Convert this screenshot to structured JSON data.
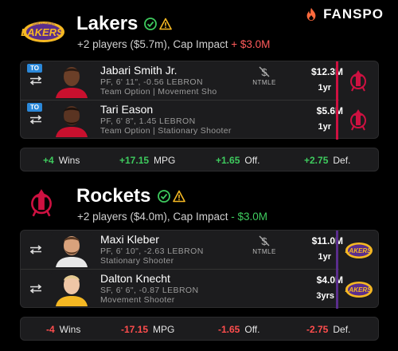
{
  "brand": {
    "name": "FANSPO",
    "icon": "flame-icon"
  },
  "teams": [
    {
      "name": "Lakers",
      "logo": "lakers-logo",
      "subtitle_prefix": "+2 players ($5.7m), Cap Impact",
      "cap_impact": "+ $3.0M",
      "players": [
        {
          "tag": "TO",
          "name": "Jabari Smith Jr.",
          "meta": "PF, 6' 11\", -0.56 LEBRON",
          "role": "Team Option | Movement Sho",
          "ntmle": "NTMLE",
          "salary": "$12.3M",
          "years": "1yr",
          "side_logo": "rockets-logo"
        },
        {
          "tag": "TO",
          "name": "Tari Eason",
          "meta": "PF, 6' 8\", 1.45 LEBRON",
          "role": "Team Option | Stationary Shooter",
          "ntmle": "",
          "salary": "$5.6M",
          "years": "1yr",
          "side_logo": "rockets-logo"
        }
      ],
      "stats": [
        {
          "value": "+4",
          "label": "Wins"
        },
        {
          "value": "+17.15",
          "label": "MPG"
        },
        {
          "value": "+1.65",
          "label": "Off."
        },
        {
          "value": "+2.75",
          "label": "Def."
        }
      ]
    },
    {
      "name": "Rockets",
      "logo": "rockets-logo",
      "subtitle_prefix": "+2 players ($4.0m), Cap Impact",
      "cap_impact": "- $3.0M",
      "players": [
        {
          "tag": "",
          "name": "Maxi Kleber",
          "meta": "PF, 6' 10\", -2.63 LEBRON",
          "role": "Stationary Shooter",
          "ntmle": "NTMLE",
          "salary": "$11.0M",
          "years": "1yr",
          "side_logo": "lakers-logo"
        },
        {
          "tag": "",
          "name": "Dalton Knecht",
          "meta": "SF, 6' 6\", -0.87 LEBRON",
          "role": "Movement Shooter",
          "ntmle": "",
          "salary": "$4.0M",
          "years": "3yrs",
          "side_logo": "lakers-logo"
        }
      ],
      "stats": [
        {
          "value": "-4",
          "label": "Wins"
        },
        {
          "value": "-17.15",
          "label": "MPG"
        },
        {
          "value": "-1.65",
          "label": "Off."
        },
        {
          "value": "-2.75",
          "label": "Def."
        }
      ]
    }
  ],
  "colors": {
    "lakers_purple": "#5a2d8c",
    "lakers_gold": "#f5b823",
    "rockets_red": "#ce1141",
    "positive": "#3ecb5e",
    "negative": "#ff4d4d",
    "brand_orange": "#ff6a3d"
  }
}
